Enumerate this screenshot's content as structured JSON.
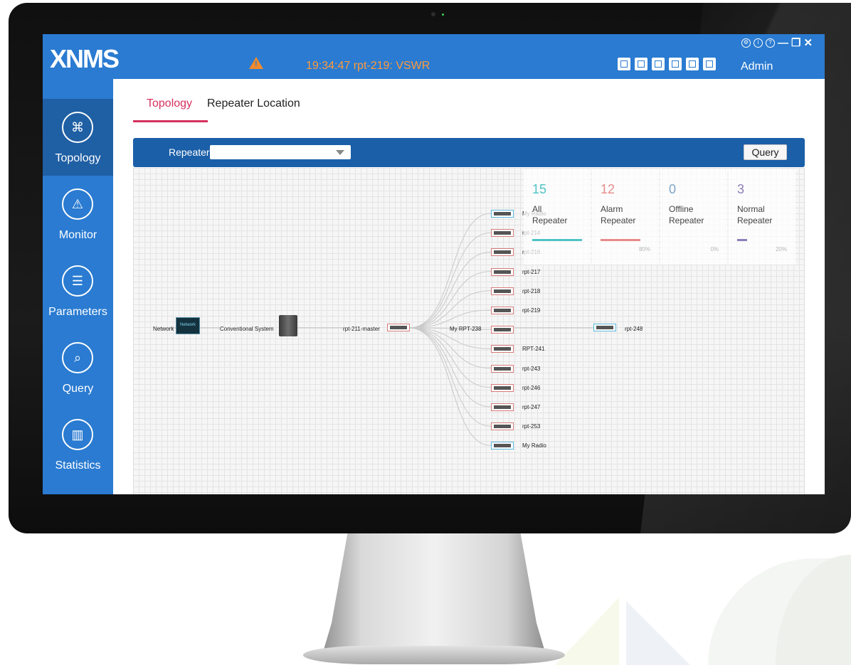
{
  "app": {
    "logo": "XNMS",
    "alarm_text": "19:34:47  rpt-219: VSWR",
    "user": "Admin",
    "toolbar_icons": [
      "map-icon",
      "report-icon",
      "globe-icon",
      "device-icon",
      "config-icon",
      "export-icon"
    ],
    "window_controls": [
      "settings-icon",
      "info-icon",
      "help-icon",
      "minimize-icon",
      "restore-icon",
      "close-icon"
    ]
  },
  "sidebar": {
    "items": [
      {
        "label": "Topology",
        "icon": "topology-icon",
        "active": true
      },
      {
        "label": "Monitor",
        "icon": "monitor-icon",
        "active": false
      },
      {
        "label": "Parameters",
        "icon": "parameters-icon",
        "active": false
      },
      {
        "label": "Query",
        "icon": "query-icon",
        "active": false
      },
      {
        "label": "Statistics",
        "icon": "statistics-icon",
        "active": false
      }
    ]
  },
  "tabs": [
    "Topology",
    "Repeater Location"
  ],
  "querybar": {
    "repeater_label": "Repeater:",
    "repeater_value": "",
    "query_button": "Query"
  },
  "stats": [
    {
      "count": "15",
      "label": "All\nRepeater",
      "pct": "",
      "color": "#4fc3c5"
    },
    {
      "count": "12",
      "label": "Alarm\nRepeater",
      "pct": "80%",
      "color": "#e78b8b"
    },
    {
      "count": "0",
      "label": "Offline\nRepeater",
      "pct": "0%",
      "color": "#7fa6c6"
    },
    {
      "count": "3",
      "label": "Normal\nRepeater",
      "pct": "20%",
      "color": "#8d7eb8"
    }
  ],
  "topology": {
    "network": "Network",
    "network_box": "Network",
    "system": "Conventional System",
    "master": "rpt-211-master",
    "hub": "My RPT-238",
    "downstream": "rpt-248",
    "slaves": [
      "My Radio",
      "rpt-214",
      "rpt-216",
      "rpt-217",
      "rpt-218",
      "rpt-219",
      "",
      "RPT-241",
      "rpt-243",
      "rpt-246",
      "rpt-247",
      "rpt-253",
      "My Radio"
    ],
    "slave_status": [
      "blue",
      "red",
      "red",
      "red",
      "red",
      "red",
      "red",
      "red",
      "red",
      "red",
      "red",
      "red",
      "blue"
    ]
  }
}
